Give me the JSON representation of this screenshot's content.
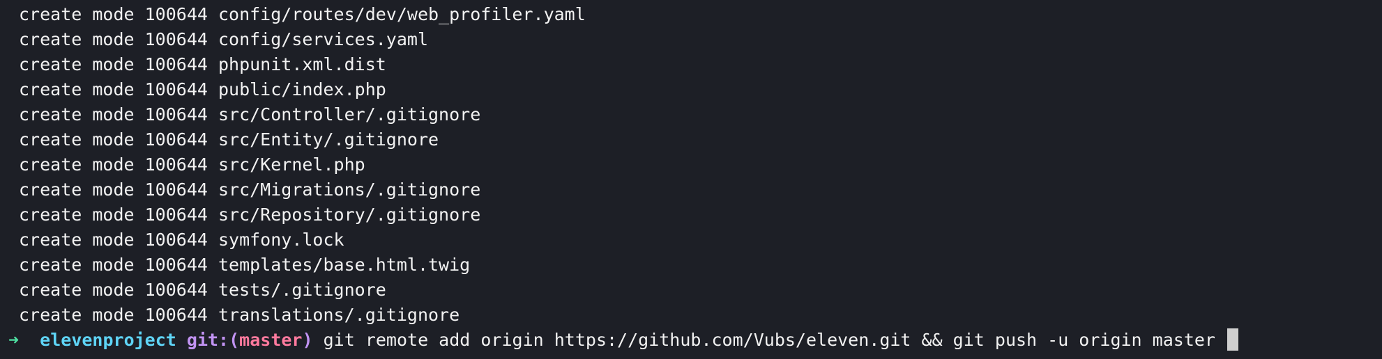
{
  "output_lines": [
    "create mode 100644 config/routes/dev/web_profiler.yaml",
    "create mode 100644 config/services.yaml",
    "create mode 100644 phpunit.xml.dist",
    "create mode 100644 public/index.php",
    "create mode 100644 src/Controller/.gitignore",
    "create mode 100644 src/Entity/.gitignore",
    "create mode 100644 src/Kernel.php",
    "create mode 100644 src/Migrations/.gitignore",
    "create mode 100644 src/Repository/.gitignore",
    "create mode 100644 symfony.lock",
    "create mode 100644 templates/base.html.twig",
    "create mode 100644 tests/.gitignore",
    "create mode 100644 translations/.gitignore"
  ],
  "prompt": {
    "arrow": "➜",
    "directory": "elevenproject",
    "git_prefix": "git:(",
    "branch": "master",
    "git_suffix": ")",
    "command": "git remote add origin https://github.com/Vubs/eleven.git && git push -u origin master"
  },
  "colors": {
    "background": "#1d1f26",
    "text": "#f2f2f2",
    "arrow": "#4fe0a2",
    "directory": "#5fd4f6",
    "git_label": "#c193f2",
    "branch": "#ff7a9e"
  }
}
